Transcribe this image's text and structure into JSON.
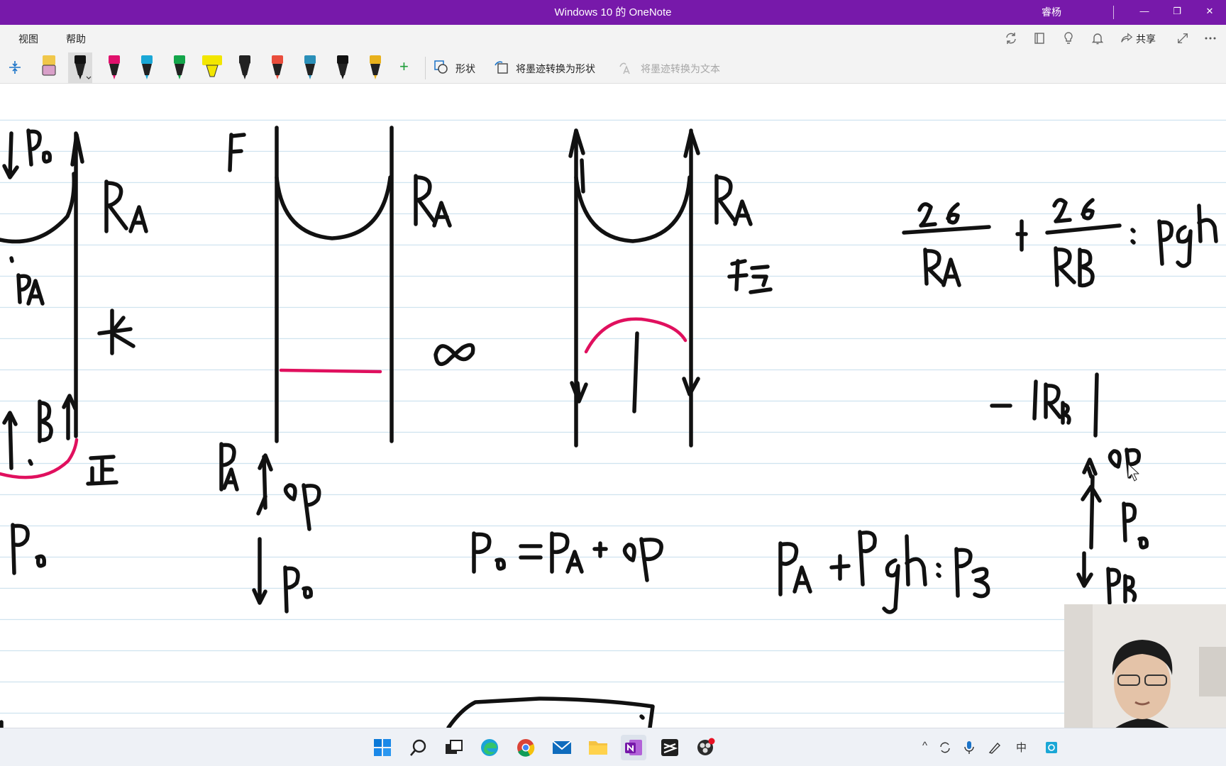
{
  "window": {
    "title": "Windows 10 的 OneNote",
    "user": "睿杨",
    "minimize_glyph": "—",
    "restore_glyph": "❐",
    "close_glyph": "✕"
  },
  "menu": {
    "view": "视图",
    "help": "帮助",
    "share": "共享"
  },
  "menu_icons": [
    "sync-icon",
    "notebook-icon",
    "lightbulb-icon",
    "bell-icon",
    "share-icon",
    "fullscreen-icon",
    "more-icon"
  ],
  "pens": [
    {
      "name": "eraser-pen",
      "color": "#d9a0c9"
    },
    {
      "name": "black-pen-selected",
      "color": "#111111"
    },
    {
      "name": "magenta-pen",
      "color": "#e0116c"
    },
    {
      "name": "cyan-pen",
      "color": "#1aa7d6"
    },
    {
      "name": "green-pen",
      "color": "#13a54a"
    },
    {
      "name": "yellow-highlighter",
      "color": "#f2e600"
    },
    {
      "name": "galaxy-pen",
      "color": "#222222"
    },
    {
      "name": "rainbow-pen",
      "color": "#e94d3c"
    },
    {
      "name": "ocean-pen",
      "color": "#2a8fb8"
    },
    {
      "name": "black-pencil",
      "color": "#111111"
    },
    {
      "name": "gold-pen",
      "color": "#e8b11c"
    }
  ],
  "toolbar": {
    "add_pen": "+",
    "shapes": "形状",
    "ink_to_shape": "将墨迹转换为形状",
    "ink_to_text": "将墨迹转换为文本"
  },
  "colors": {
    "titlebar": "#7719aa",
    "ink": "#111111",
    "ink_red": "#e0105e",
    "rule_lines": "#cfe3ef"
  },
  "taskbar": {
    "apps": [
      "windows-start-icon",
      "search-icon",
      "task-view-icon",
      "edge-icon",
      "chrome-icon",
      "mail-icon",
      "file-explorer-icon",
      "onenote-icon",
      "capcut-icon",
      "obs-icon"
    ],
    "ime": "中",
    "tray_chevron": "^"
  }
}
